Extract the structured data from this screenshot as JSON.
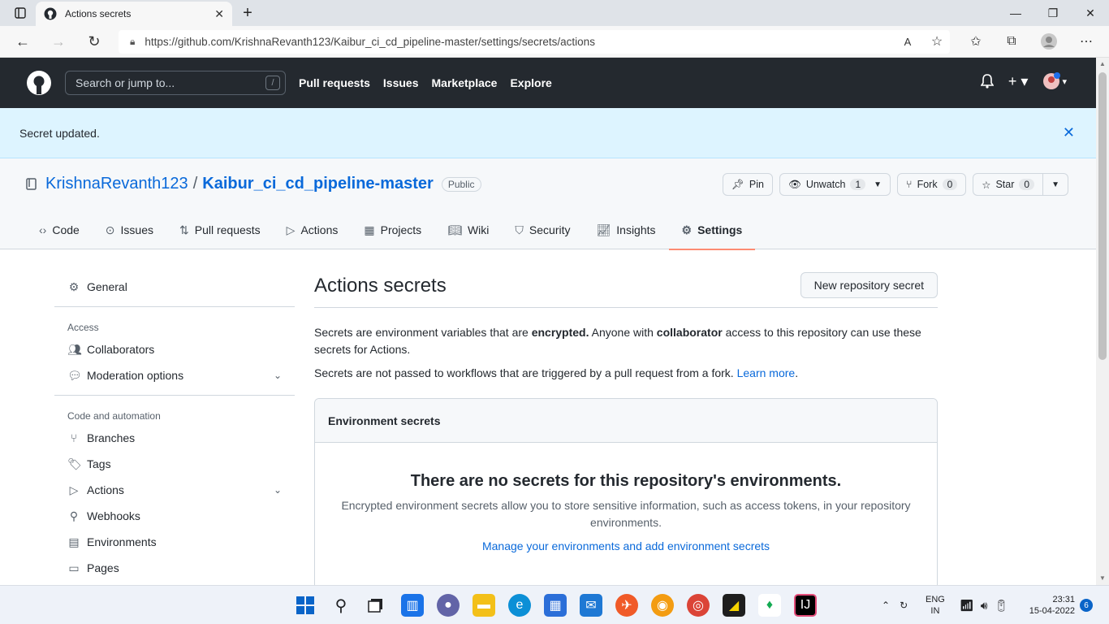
{
  "browser": {
    "tab_title": "Actions secrets",
    "url": "https://github.com/KrishnaRevanth123/Kaibur_ci_cd_pipeline-master/settings/secrets/actions"
  },
  "gh_header": {
    "search_placeholder": "Search or jump to...",
    "search_shortcut": "/",
    "nav": [
      "Pull requests",
      "Issues",
      "Marketplace",
      "Explore"
    ]
  },
  "flash": {
    "message": "Secret updated."
  },
  "repo": {
    "owner": "KrishnaRevanth123",
    "separator": "/",
    "name": "Kaibur_ci_cd_pipeline-master",
    "visibility": "Public",
    "pin_label": "Pin",
    "unwatch_label": "Unwatch",
    "unwatch_count": "1",
    "fork_label": "Fork",
    "fork_count": "0",
    "star_label": "Star",
    "star_count": "0",
    "tabs": [
      {
        "label": "Code",
        "icon": "code-icon"
      },
      {
        "label": "Issues",
        "icon": "issue-icon"
      },
      {
        "label": "Pull requests",
        "icon": "pull-request-icon"
      },
      {
        "label": "Actions",
        "icon": "play-icon"
      },
      {
        "label": "Projects",
        "icon": "table-icon"
      },
      {
        "label": "Wiki",
        "icon": "book-icon"
      },
      {
        "label": "Security",
        "icon": "shield-icon"
      },
      {
        "label": "Insights",
        "icon": "graph-icon"
      },
      {
        "label": "Settings",
        "icon": "gear-icon"
      }
    ]
  },
  "sidebar": {
    "general": "General",
    "access_heading": "Access",
    "collaborators": "Collaborators",
    "moderation": "Moderation options",
    "code_heading": "Code and automation",
    "branches": "Branches",
    "tags": "Tags",
    "actions": "Actions",
    "webhooks": "Webhooks",
    "environments": "Environments",
    "pages": "Pages"
  },
  "main": {
    "title": "Actions secrets",
    "new_button": "New repository secret",
    "desc_part1": "Secrets are environment variables that are ",
    "desc_bold1": "encrypted.",
    "desc_part2": " Anyone with ",
    "desc_bold2": "collaborator",
    "desc_part3": " access to this repository can use these secrets for Actions.",
    "desc2_text": "Secrets are not passed to workflows that are triggered by a pull request from a fork. ",
    "learn_more": "Learn more",
    "desc2_end": ".",
    "env_heading": "Environment secrets",
    "blank_title": "There are no secrets for this repository's environments.",
    "blank_desc": "Encrypted environment secrets allow you to store sensitive information, such as access tokens, in your repository environments.",
    "manage_link": "Manage your environments and add environment secrets"
  },
  "taskbar": {
    "lang_line1": "ENG",
    "lang_line2": "IN",
    "time": "23:31",
    "date": "15-04-2022",
    "notifications": "6"
  },
  "colors": {
    "header_bg": "#24292f",
    "flash_bg": "#ddf4ff",
    "link": "#0969da",
    "active_tab_underline": "#fd8c73"
  }
}
